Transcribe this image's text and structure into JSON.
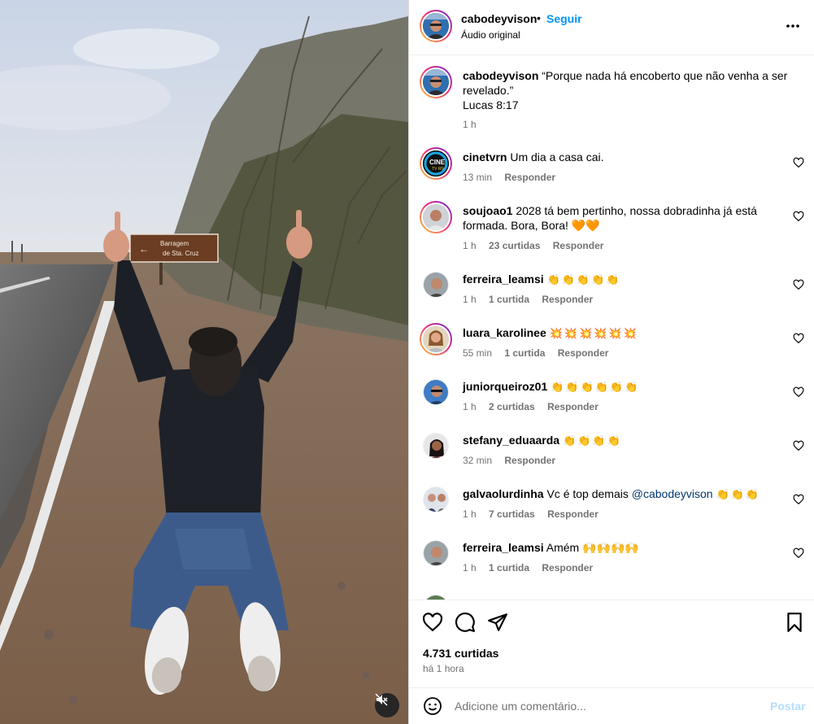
{
  "header": {
    "username": "cabodeyvison",
    "separator": "•",
    "follow_label": "Seguir",
    "audio": "Áudio original"
  },
  "media": {
    "sign_line1": "Barragem",
    "sign_line2": "de Sta. Cruz"
  },
  "caption": {
    "username": "cabodeyvison",
    "text": "“Porque nada há encoberto que não venha a ser revelado.”",
    "reference": "Lucas 8:17",
    "time": "1 h"
  },
  "comments": [
    {
      "username": "cinetvrn",
      "text": "Um dia a casa cai.",
      "time": "13 min",
      "likes": "",
      "reply": "Responder"
    },
    {
      "username": "soujoao1",
      "text": "2028 tá bem pertinho, nossa dobradinha já está formada. Bora, Bora! 🧡🧡",
      "time": "1 h",
      "likes": "23 curtidas",
      "reply": "Responder"
    },
    {
      "username": "ferreira_leamsi",
      "text": "👏👏👏👏👏",
      "time": "1 h",
      "likes": "1 curtida",
      "reply": "Responder"
    },
    {
      "username": "luara_karolinee",
      "text": "💥💥💥💥💥💥",
      "time": "55 min",
      "likes": "1 curtida",
      "reply": "Responder"
    },
    {
      "username": "juniorqueiroz01",
      "text": "👏👏👏👏👏👏",
      "time": "1 h",
      "likes": "2 curtidas",
      "reply": "Responder"
    },
    {
      "username": "stefany_eduaarda",
      "text": "👏👏👏👏",
      "time": "32 min",
      "likes": "",
      "reply": "Responder"
    },
    {
      "username": "galvaolurdinha",
      "text": "Vc é top demais",
      "mention": "@cabodeyvison",
      "trailing": "👏👏👏",
      "time": "1 h",
      "likes": "7 curtidas",
      "reply": "Responder"
    },
    {
      "username": "ferreira_leamsi",
      "text": "Amém 🙌🙌🙌🙌",
      "time": "1 h",
      "likes": "1 curtida",
      "reply": "Responder"
    }
  ],
  "footer": {
    "likes": "4.731 curtidas",
    "time_ago": "há 1 hora",
    "comment_placeholder": "Adicione um comentário...",
    "post_label": "Postar"
  },
  "colors": {
    "accent": "#0095f6",
    "muted": "#737373",
    "post_disabled": "#b2dffc"
  }
}
